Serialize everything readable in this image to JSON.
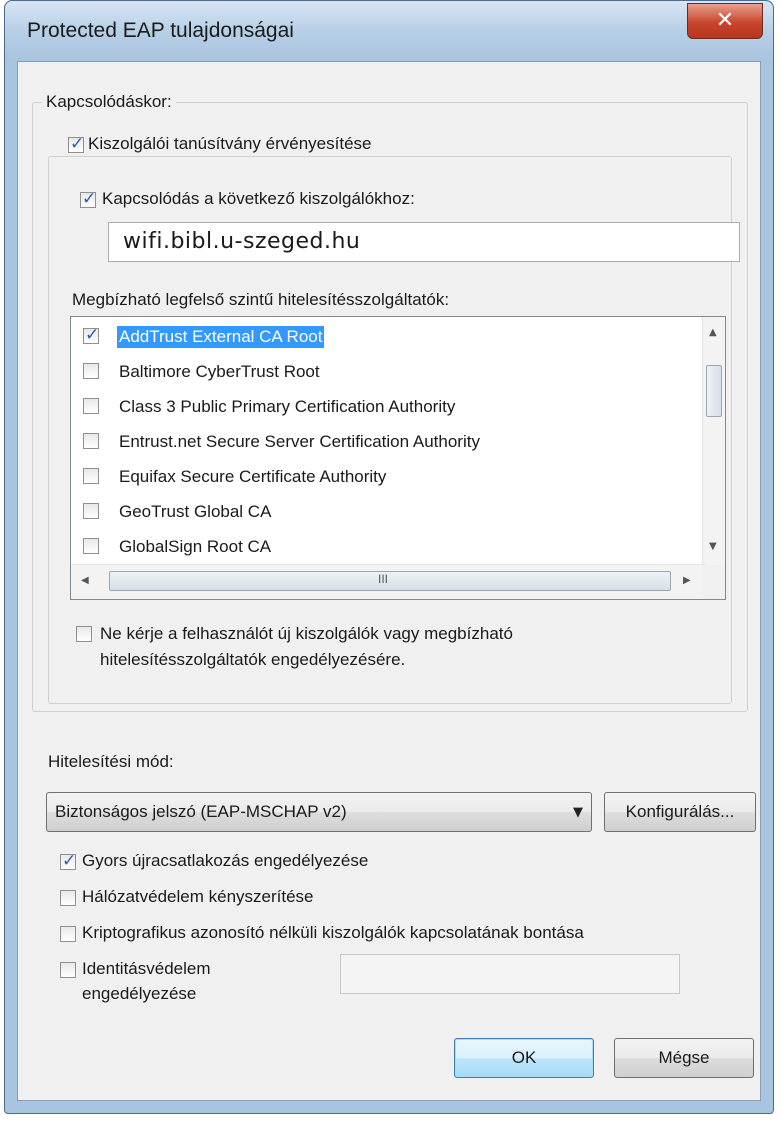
{
  "window": {
    "title": "Protected EAP tulajdonságai",
    "close_glyph": "✕"
  },
  "connect": {
    "group_label": "Kapcsolódáskor:",
    "validate_cert": {
      "label": "Kiszolgálói tanúsítvány érvényesítése",
      "checked": true
    },
    "connect_servers": {
      "label": "Kapcsolódás a következő kiszolgálókhoz:",
      "checked": true
    },
    "server_value": "wifi.bibl.u-szeged.hu",
    "trusted_label": "Megbízható legfelső szintű hitelesítésszolgáltatók:",
    "ca_list": [
      {
        "label": "AddTrust External CA Root",
        "checked": true,
        "selected": true
      },
      {
        "label": "Baltimore CyberTrust Root",
        "checked": false,
        "selected": false
      },
      {
        "label": "Class 3 Public Primary Certification Authority",
        "checked": false,
        "selected": false
      },
      {
        "label": "Entrust.net Secure Server Certification Authority",
        "checked": false,
        "selected": false
      },
      {
        "label": "Equifax Secure Certificate Authority",
        "checked": false,
        "selected": false
      },
      {
        "label": "GeoTrust Global CA",
        "checked": false,
        "selected": false
      },
      {
        "label": "GlobalSign Root CA",
        "checked": false,
        "selected": false
      }
    ],
    "hscroll_grip": "III",
    "no_prompt": {
      "line1": "Ne kérje a felhasználót új kiszolgálók vagy megbízható",
      "line2": "hitelesítésszolgáltatók engedélyezésére.",
      "checked": false
    }
  },
  "auth": {
    "label": "Hitelesítési mód:",
    "method_value": "Biztonságos jelszó (EAP-MSCHAP v2)",
    "configure_label": "Konfigurálás..."
  },
  "options": [
    {
      "label": "Gyors újracsatlakozás engedélyezése",
      "checked": true
    },
    {
      "label": "Hálózatvédelem kényszerítése",
      "checked": false
    },
    {
      "label": "Kriptografikus azonosító nélküli kiszolgálók kapcsolatának bontása",
      "checked": false
    }
  ],
  "identity": {
    "line1": "Identitásvédelem",
    "line2": "engedélyezése",
    "checked": false,
    "value": ""
  },
  "buttons": {
    "ok": "OK",
    "cancel": "Mégse"
  }
}
